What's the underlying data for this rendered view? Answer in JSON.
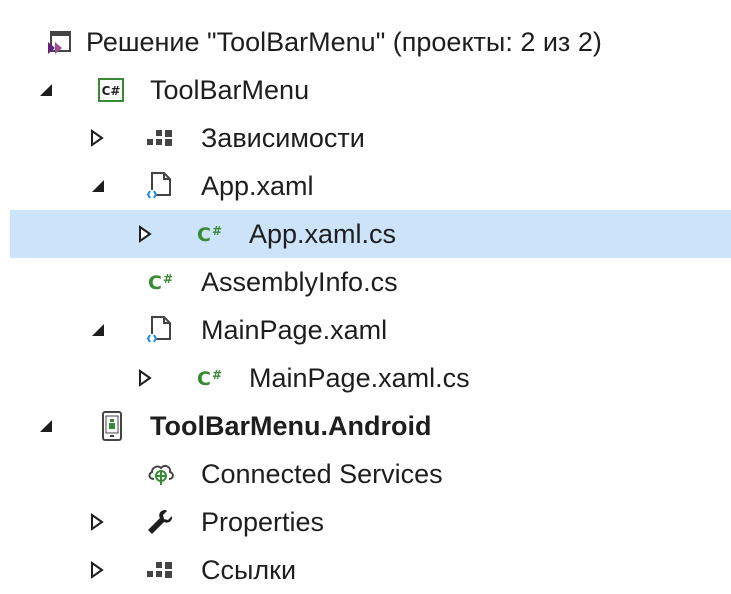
{
  "tree": {
    "solution": {
      "label": "Решение \"ToolBarMenu\" (проекты: 2 из 2)",
      "icon": "vs-solution-icon"
    },
    "items": [
      {
        "label": "ToolBarMenu",
        "icon": "csharp-project-icon",
        "expander": "expanded"
      },
      {
        "label": "Зависимости",
        "icon": "dependencies-icon",
        "expander": "collapsed"
      },
      {
        "label": "App.xaml",
        "icon": "xaml-file-icon",
        "expander": "expanded"
      },
      {
        "label": "App.xaml.cs",
        "icon": "csharp-file-icon",
        "expander": "collapsed",
        "selected": true
      },
      {
        "label": "AssemblyInfo.cs",
        "icon": "csharp-file-icon",
        "expander": "none"
      },
      {
        "label": "MainPage.xaml",
        "icon": "xaml-file-icon",
        "expander": "expanded"
      },
      {
        "label": "MainPage.xaml.cs",
        "icon": "csharp-file-icon",
        "expander": "collapsed"
      },
      {
        "label": "ToolBarMenu.Android",
        "icon": "android-project-icon",
        "expander": "expanded",
        "bold": true
      },
      {
        "label": "Connected Services",
        "icon": "connected-services-icon",
        "expander": "none"
      },
      {
        "label": "Properties",
        "icon": "wrench-icon",
        "expander": "collapsed"
      },
      {
        "label": "Ссылки",
        "icon": "references-icon",
        "expander": "collapsed"
      }
    ]
  },
  "colors": {
    "selection": "#cce3f9",
    "csharp_green": "#388a34",
    "vs_purple": "#68217a",
    "xaml_blue": "#1e88e5"
  }
}
